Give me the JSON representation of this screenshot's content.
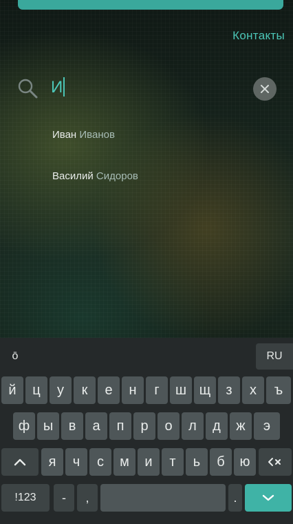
{
  "header": {
    "title": "Контакты"
  },
  "search": {
    "query": "И"
  },
  "results": [
    {
      "first": "Иван",
      "last": "Иванов"
    },
    {
      "first": "Василий",
      "last": "Сидоров"
    }
  ],
  "keyboard": {
    "mode_symbol": "ō",
    "language": "RU",
    "row1": [
      "й",
      "ц",
      "у",
      "к",
      "е",
      "н",
      "г",
      "ш",
      "щ",
      "з",
      "х",
      "ъ"
    ],
    "row2": [
      "ф",
      "ы",
      "в",
      "а",
      "п",
      "р",
      "о",
      "л",
      "д",
      "ж",
      "э"
    ],
    "row3": [
      "я",
      "ч",
      "с",
      "м",
      "и",
      "т",
      "ь",
      "б",
      "ю"
    ],
    "shift_icon": "shift-caret-icon",
    "backspace_icon": "backspace-icon",
    "bottom": {
      "numbers": "!123",
      "dash": "-",
      "comma": ",",
      "period": ".",
      "enter_icon": "chevron-down-icon"
    }
  },
  "colors": {
    "accent": "#3fb3a6",
    "accent_text": "#4cc7b8",
    "keyboard_bg": "#25292a",
    "key_bg": "#4e5658"
  }
}
